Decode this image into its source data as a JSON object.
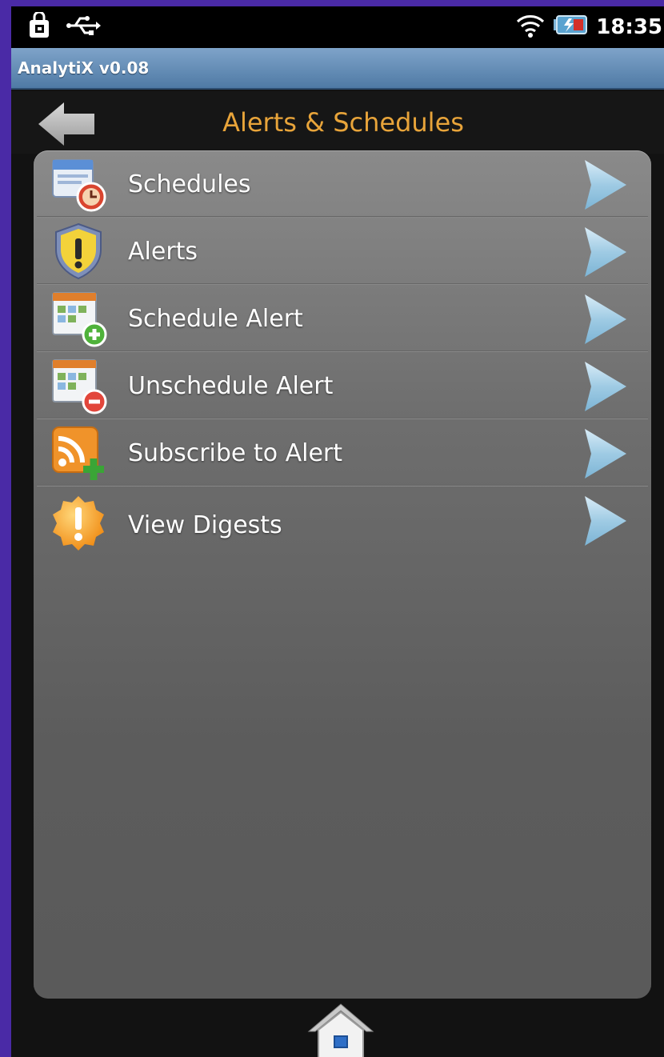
{
  "status_bar": {
    "time": "18:35",
    "icons": [
      "lock-bag-icon",
      "usb-icon",
      "wifi-icon",
      "battery-icon"
    ]
  },
  "app": {
    "title": "AnalytiX v0.08"
  },
  "header": {
    "title": "Alerts & Schedules",
    "back_icon": "back-arrow-icon"
  },
  "menu": {
    "items": [
      {
        "label": "Schedules",
        "icon": "calendar-clock-icon"
      },
      {
        "label": "Alerts",
        "icon": "shield-warning-icon"
      },
      {
        "label": "Schedule Alert",
        "icon": "calendar-add-icon"
      },
      {
        "label": "Unschedule Alert",
        "icon": "calendar-remove-icon"
      },
      {
        "label": "Subscribe to Alert",
        "icon": "rss-add-icon"
      },
      {
        "label": "View Digests",
        "icon": "exclamation-badge-icon"
      }
    ]
  },
  "footer": {
    "home_icon": "home-icon"
  },
  "colors": {
    "accent": "#e8a43a",
    "titlebar": "#5f86ae",
    "panel": "#6e6e6e"
  }
}
